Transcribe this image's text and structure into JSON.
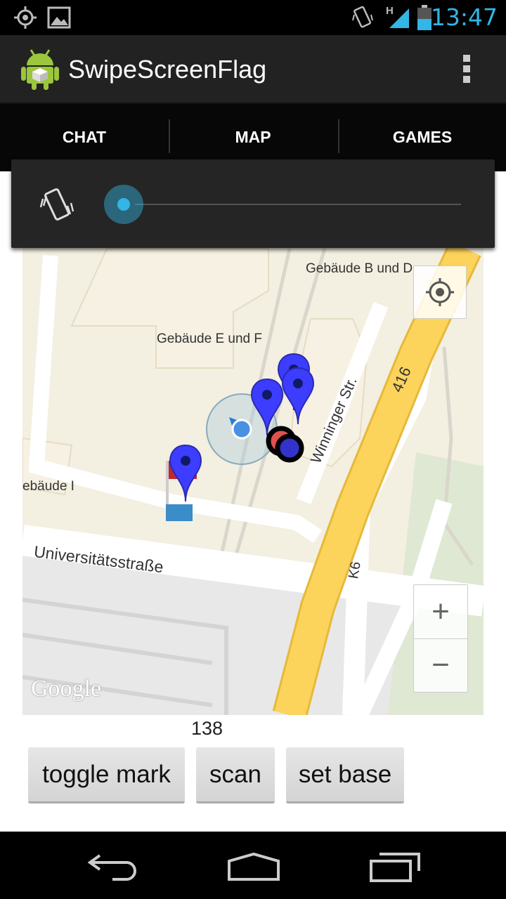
{
  "status_bar": {
    "time": "13:47",
    "network": "H"
  },
  "app": {
    "title": "SwipeScreenFlag"
  },
  "tabs": [
    {
      "label": "CHAT"
    },
    {
      "label": "MAP"
    },
    {
      "label": "GAMES"
    }
  ],
  "volume_panel": {
    "level": 0
  },
  "map": {
    "labels": {
      "building_bd": "Gebäude B und D",
      "building_ef": "Gebäude E und F",
      "building_i": "ebäude I",
      "street_uni": "Universitätsstraße",
      "street_winninger": "Winninger Str.",
      "road_416": "416",
      "road_k6": "K6"
    },
    "logo": "Google",
    "zoom_in": "+",
    "zoom_out": "−"
  },
  "counter": "138",
  "buttons": {
    "toggle_mark": "toggle mark",
    "scan": "scan",
    "set_base": "set base"
  },
  "colors": {
    "accent": "#33b5e5",
    "marker": "#3d3dff",
    "road": "#fcd35b"
  }
}
